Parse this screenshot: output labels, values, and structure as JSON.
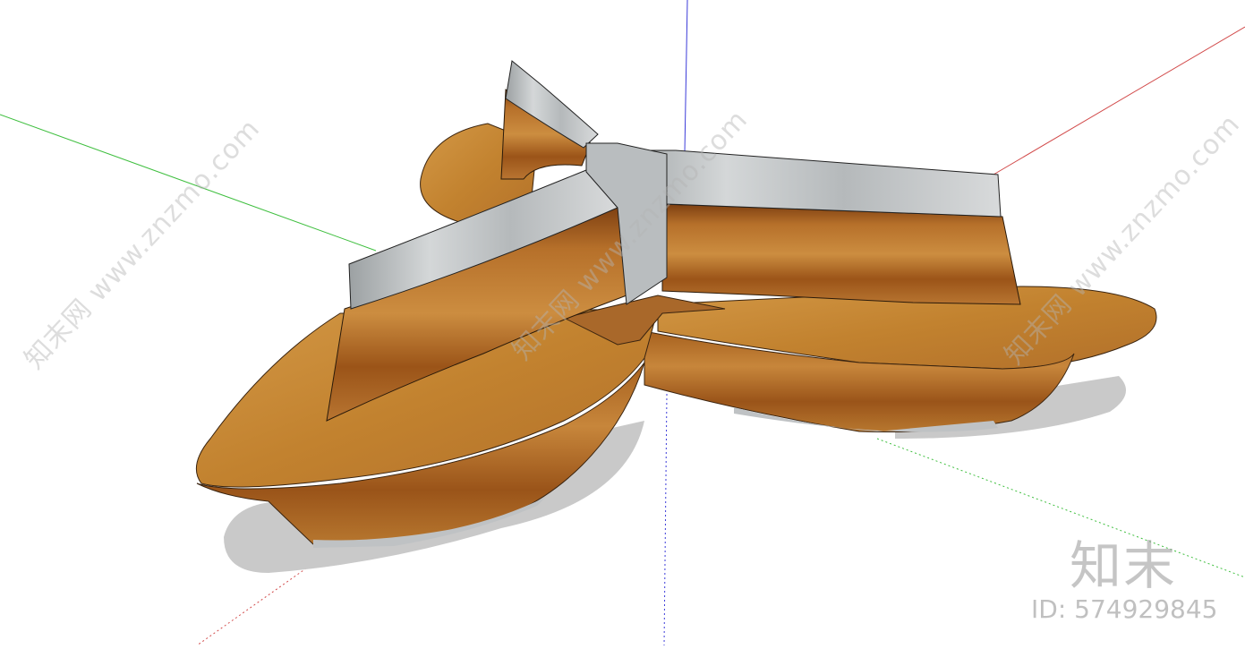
{
  "scene": {
    "object": "three-wing wooden bench with concrete backrest",
    "colors": {
      "wood_light": "#c98a3a",
      "wood_mid": "#b06a24",
      "wood_dark": "#7a3f10",
      "concrete": "#c8cbcc",
      "concrete_dark": "#8f9496",
      "axis_red": "#d24b4b",
      "axis_green": "#3fbf3f",
      "axis_blue": "#3b3bd9",
      "shadow": "#c9c9c9"
    }
  },
  "watermarks": {
    "diagonal_text": "知末网 www.znzmo.com",
    "logo_text": "知末",
    "id_text": "ID: 574929845"
  }
}
